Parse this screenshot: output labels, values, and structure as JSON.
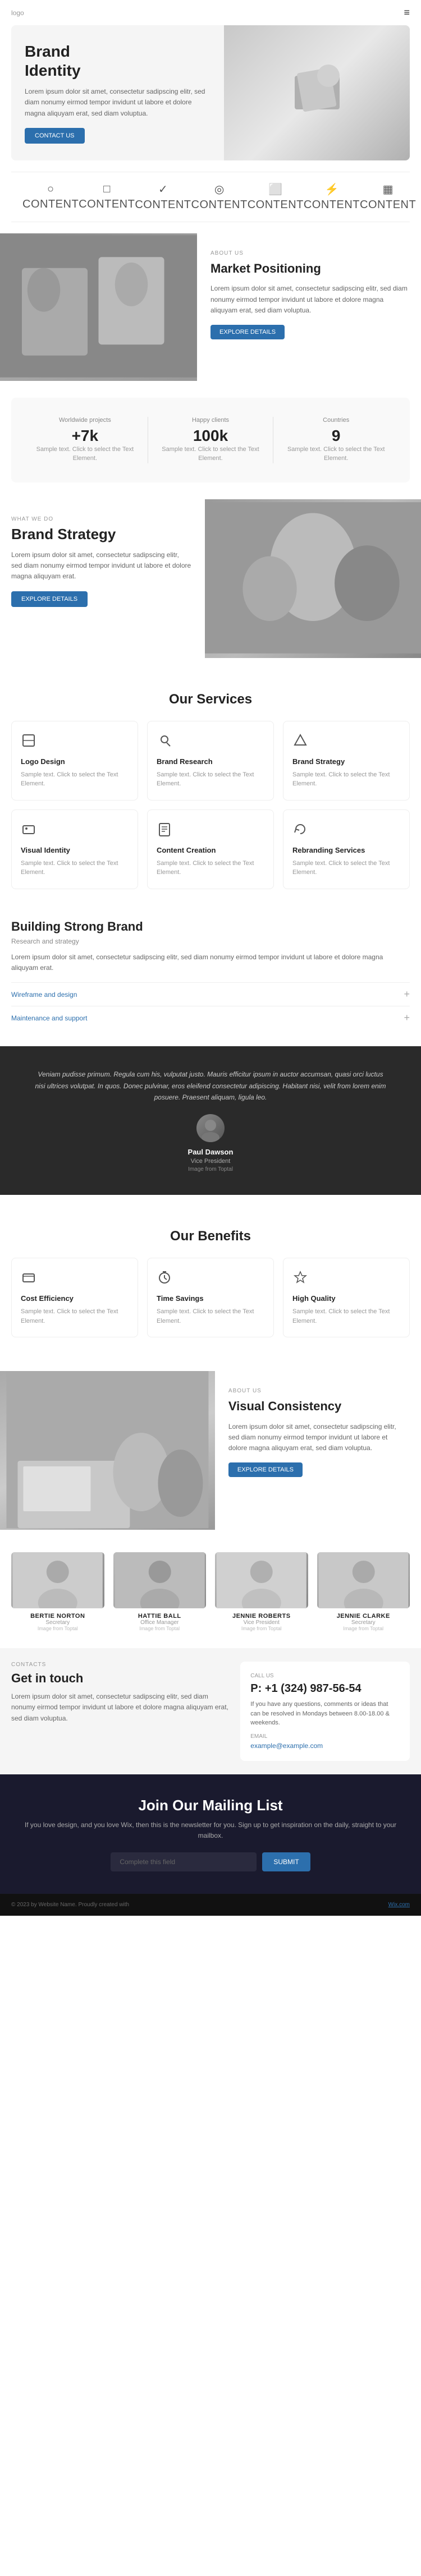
{
  "header": {
    "logo": "logo",
    "menu_icon": "≡"
  },
  "hero": {
    "title": "Brand\nIdentity",
    "description": "Lorem ipsum dolor sit amet, consectetur sadipscing elitr, sed diam nonumy eirmod tempor invidunt ut labore et dolore magna aliquyam erat, sed diam voluptua.",
    "cta_label": "CONTACT US"
  },
  "icons_row": [
    {
      "icon": "○",
      "label": "CONTENT"
    },
    {
      "icon": "□",
      "label": "CONTENT"
    },
    {
      "icon": "✓",
      "label": "CONTENT"
    },
    {
      "icon": "◎",
      "label": "CONTENT"
    },
    {
      "icon": "⬜",
      "label": "CONTENT"
    },
    {
      "icon": "⚡",
      "label": "CONTENT"
    },
    {
      "icon": "▦",
      "label": "CONTENT"
    }
  ],
  "about": {
    "label": "ABOUT US",
    "title": "Market Positioning",
    "description": "Lorem ipsum dolor sit amet, consectetur sadipscing elitr, sed diam nonumy eirmod tempor invidunt ut labore et dolore magna aliquyam erat, sed diam voluptua.",
    "cta_label": "EXPLORE DETAILS"
  },
  "stats": [
    {
      "value": "+7k",
      "title": "Worldwide projects",
      "desc": "Sample text. Click to select the Text Element."
    },
    {
      "value": "100k",
      "title": "Happy clients",
      "desc": "Sample text. Click to select the Text Element."
    },
    {
      "value": "9",
      "title": "Countries",
      "desc": "Sample text. Click to select the Text Element."
    }
  ],
  "brand_strategy": {
    "label": "WHAT WE DO",
    "title": "Brand Strategy",
    "description": "Lorem ipsum dolor sit amet, consectetur sadipscing elitr, sed diam nonumy eirmod tempor invidunt ut labore et dolore magna aliquyam erat.",
    "cta_label": "EXPLORE DETAILS"
  },
  "services": {
    "title": "Our Services",
    "items": [
      {
        "icon": "◻",
        "name": "Logo Design",
        "desc": "Sample text. Click to select the Text Element."
      },
      {
        "icon": "◻",
        "name": "Brand Research",
        "desc": "Sample text. Click to select the Text Element."
      },
      {
        "icon": "◻",
        "name": "Brand Strategy",
        "desc": "Sample text. Click to select the Text Element."
      },
      {
        "icon": "◻",
        "name": "Visual Identity",
        "desc": "Sample text. Click to select the Text Element."
      },
      {
        "icon": "◻",
        "name": "Content Creation",
        "desc": "Sample text. Click to select the Text Element."
      },
      {
        "icon": "◻",
        "name": "Rebranding Services",
        "desc": "Sample text. Click to select the Text Element."
      }
    ]
  },
  "accordion": {
    "title": "Building Strong Brand",
    "subtitle": "Research and strategy",
    "description": "Lorem ipsum dolor sit amet, consectetur sadipscing elitr, sed diam nonumy eirmod tempor invidunt ut labore et dolore magna aliquyam erat.",
    "items": [
      {
        "label": "Wireframe and design"
      },
      {
        "label": "Maintenance and support"
      }
    ]
  },
  "testimonial": {
    "quote": "Veniam pudisse primum. Regula cum his, vulputat justo. Mauris efficitur ipsum in auctor accumsan, quasi orci luctus nisi ultrices volutpat. In quos. Donec pulvinar, eros eleifend consectetur adipiscing. Habitant nisi, velit from lorem enim posuere. Praesent aliquam, ligula leo.",
    "name": "Paul Dawson",
    "role": "Vice President",
    "source": "Image from Toptal"
  },
  "benefits": {
    "title": "Our Benefits",
    "items": [
      {
        "icon": "◻",
        "name": "Cost Efficiency",
        "desc": "Sample text. Click to select the Text Element."
      },
      {
        "icon": "⊙",
        "name": "Time Savings",
        "desc": "Sample text. Click to select the Text Element."
      },
      {
        "icon": "◻",
        "name": "High Quality",
        "desc": "Sample text. Click to select the Text Element."
      }
    ]
  },
  "visual": {
    "label": "ABOUT US",
    "title": "Visual Consistency",
    "description": "Lorem ipsum dolor sit amet, consectetur sadipscing elitr, sed diam nonumy eirmod tempor invidunt ut labore et dolore magna aliquyam erat, sed diam voluptua.",
    "cta_label": "EXPLORE DETAILS"
  },
  "team": {
    "members": [
      {
        "name": "BERTIE NORTON",
        "role": "Secretary",
        "source": "Image from Toptal"
      },
      {
        "name": "HATTIE BALL",
        "role": "Office Manager",
        "source": "Image from Toptal"
      },
      {
        "name": "JENNIE ROBERTS",
        "role": "Vice President",
        "source": "Image from Toptal"
      },
      {
        "name": "JENNIE CLARKE",
        "role": "Secretary",
        "source": "Image from Toptal"
      }
    ]
  },
  "contact": {
    "label": "CONTACTS",
    "title": "Get in touch",
    "description": "Lorem ipsum dolor sit amet, consectetur sadipscing elitr, sed diam nonumy eirmod tempor invidunt ut labore et dolore magna aliquyam erat, sed diam voluptua.",
    "call_label": "CALL US",
    "phone": "P: +1 (324) 987-56-54",
    "call_desc": "If you have any questions, comments or ideas that can be resolved in Mondays between 8.00-18.00 & weekends.",
    "email_label": "EMAIL",
    "email": "example@example.com"
  },
  "mailing": {
    "title": "Join Our Mailing List",
    "description": "If you love design, and you love Wix, then this is the newsletter for you. Sign up to get inspiration on the daily, straight to your mailbox.",
    "input_placeholder": "Complete this field",
    "submit_label": "SUBMIT"
  },
  "footer": {
    "text": "© 2023 by Website Name. Proudly created with",
    "link_text": "Wix.com"
  }
}
